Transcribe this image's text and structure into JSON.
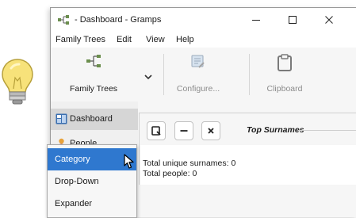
{
  "window": {
    "title": "- Dashboard - Gramps",
    "controls": {
      "minimize": "minimize-icon",
      "maximize": "maximize-icon",
      "close": "close-icon"
    }
  },
  "menubar": {
    "items": [
      "Family Trees",
      "Edit",
      "View",
      "Help"
    ]
  },
  "toolbar": {
    "family_trees": "Family Trees",
    "configure": "Configure...",
    "clipboard": "Clipboard"
  },
  "sidebar": {
    "items": [
      {
        "label": "Dashboard",
        "icon": "dashboard-icon"
      },
      {
        "label": "People",
        "icon": "people-icon"
      }
    ]
  },
  "gramplet": {
    "title": "Top Surnames",
    "lines": [
      "Total unique surnames: 0",
      "Total people: 0"
    ]
  },
  "popup": {
    "items": [
      "Category",
      "Drop-Down",
      "Expander"
    ],
    "selected": "Category"
  },
  "colors": {
    "selection": "#2f78cf",
    "bulb": "#f7e27a"
  }
}
